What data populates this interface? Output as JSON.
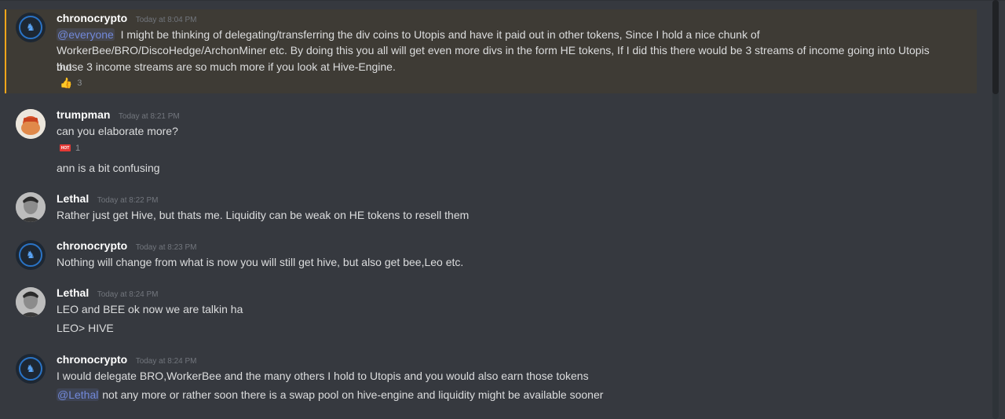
{
  "messages": [
    {
      "username": "chronocrypto",
      "timestamp": "Today at 8:04 PM",
      "mention": "@everyone",
      "line1": "I might be thinking of delegating/transferring the div coins to Utopis and have it paid out in other tokens, Since I hold a nice chunk of",
      "line2": "WorkerBee/BRO/DiscoHedge/ArchonMiner etc. By doing this you all will get even more divs in the form HE tokens, If I did this there would be 3 streams of income going into Utopis but",
      "line3": "those 3 income streams are so much more if you look at Hive-Engine.",
      "reaction_emoji": "👍",
      "reaction_count": "3"
    },
    {
      "username": "trumpman",
      "timestamp": "Today at 8:21 PM",
      "line1": "can you elaborate more?",
      "reaction_badge": "HOT",
      "reaction_count": "1",
      "line2": "ann is a bit confusing"
    },
    {
      "username": "Lethal",
      "timestamp": "Today at 8:22 PM",
      "line1": "Rather just get Hive, but thats me. Liquidity can be weak on HE tokens to resell them"
    },
    {
      "username": "chronocrypto",
      "timestamp": "Today at 8:23 PM",
      "line1": "Nothing will change from what is now you will still get hive, but also get bee,Leo etc."
    },
    {
      "username": "Lethal",
      "timestamp": "Today at 8:24 PM",
      "line1": "LEO and BEE ok now we are talkin ha",
      "line2": "LEO> HIVE"
    },
    {
      "username": "chronocrypto",
      "timestamp": "Today at 8:24 PM",
      "line1": "I would delegate BRO,WorkerBee and the many others I hold to Utopis and you would also earn those tokens",
      "mention": "@Lethal",
      "line2": "not any more or rather soon there is a swap pool on hive-engine and liquidity might be available sooner"
    }
  ],
  "colors": {
    "background": "#36393f",
    "highlight_bg": "#3e3b35",
    "highlight_bar": "#faa61a",
    "mention": "#7289da",
    "username": "#ffffff",
    "timestamp": "#72767d"
  }
}
